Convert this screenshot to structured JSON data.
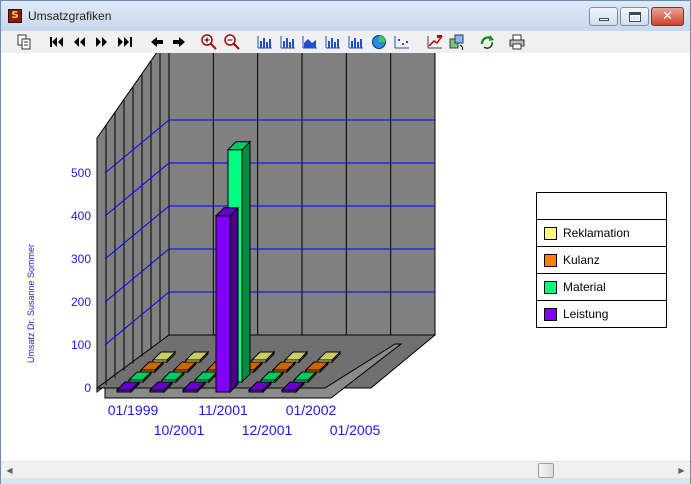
{
  "window": {
    "title": "Umsatzgrafiken",
    "icon_letter": "S",
    "close_glyph": "✕"
  },
  "toolbar": {
    "buttons": [
      {
        "name": "copy-icon",
        "glyph": "copy"
      },
      {
        "name": "first-record-icon",
        "glyph": "first"
      },
      {
        "name": "previous-page-icon",
        "glyph": "prevpage"
      },
      {
        "name": "next-page-icon",
        "glyph": "nextpage"
      },
      {
        "name": "last-record-icon",
        "glyph": "last"
      },
      {
        "name": "previous-record-icon",
        "glyph": "prev"
      },
      {
        "name": "next-record-icon",
        "glyph": "next"
      },
      {
        "name": "zoom-in-icon",
        "glyph": "zoomin"
      },
      {
        "name": "zoom-out-icon",
        "glyph": "zoomout"
      },
      {
        "name": "bar-chart-icon",
        "glyph": "bar"
      },
      {
        "name": "grouped-bar-chart-icon",
        "glyph": "bar"
      },
      {
        "name": "area-chart-icon",
        "glyph": "area"
      },
      {
        "name": "stacked-bar-chart-icon",
        "glyph": "bar"
      },
      {
        "name": "bar-chart-3d-icon",
        "glyph": "bar"
      },
      {
        "name": "pie-chart-icon",
        "glyph": "pie"
      },
      {
        "name": "scatter-chart-icon",
        "glyph": "scatter"
      },
      {
        "name": "chart-settings-icon",
        "glyph": "settings"
      },
      {
        "name": "rotate-3d-icon",
        "glyph": "rotate"
      },
      {
        "name": "refresh-icon",
        "glyph": "refresh"
      },
      {
        "name": "print-icon",
        "glyph": "print"
      }
    ]
  },
  "chart_data": {
    "type": "bar",
    "ylabel": "Umsatz Dr. Susanne Sommer",
    "yticks": [
      "0",
      "100",
      "200",
      "300",
      "400",
      "500"
    ],
    "ylim": [
      0,
      580
    ],
    "categories_row1": [
      "01/1999",
      "11/2001",
      "01/2002"
    ],
    "categories_row2": [
      "10/2001",
      "12/2001",
      "01/2005"
    ],
    "categories": [
      "01/1999",
      "10/2001",
      "11/2001",
      "12/2001",
      "01/2002",
      "01/2005"
    ],
    "series": [
      {
        "name": "Reklamation",
        "color": "#ffff80",
        "values": [
          0,
          0,
          0,
          0,
          0,
          0
        ]
      },
      {
        "name": "Kulanz",
        "color": "#ff8000",
        "values": [
          0,
          0,
          0,
          0,
          0,
          0
        ]
      },
      {
        "name": "Material",
        "color": "#00ff80",
        "values": [
          0,
          0,
          0,
          540,
          0,
          0
        ]
      },
      {
        "name": "Leistung",
        "color": "#8000ff",
        "values": [
          0,
          0,
          0,
          410,
          0,
          0
        ]
      }
    ],
    "grid": true,
    "legend_position": "right"
  },
  "colors": {
    "wall": "#808080",
    "gridline": "#0000ff",
    "axis_text": "#1a1aff"
  }
}
